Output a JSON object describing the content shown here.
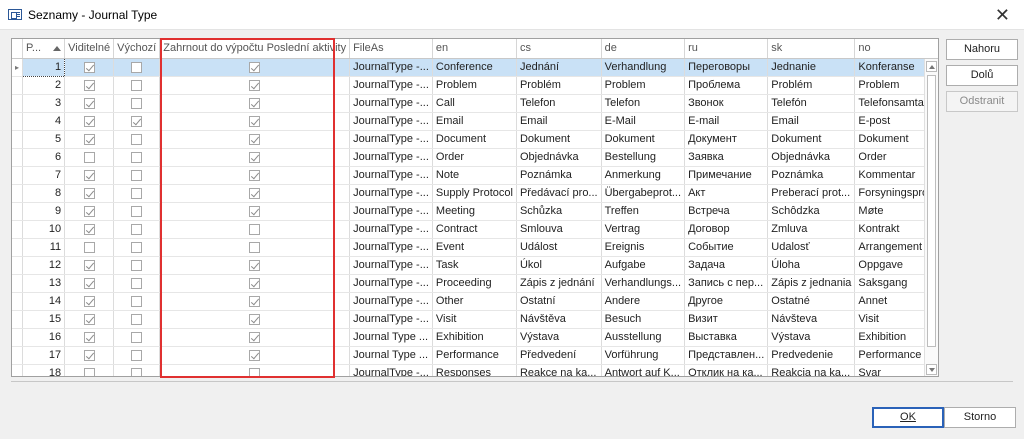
{
  "window": {
    "title": "Seznamy - Journal Type",
    "close_label": "✕"
  },
  "columns": [
    "P...",
    "Viditelné",
    "Výchozí",
    "Zahrnout do výpočtu Poslední aktivity",
    "FileAs",
    "en",
    "cs",
    "de",
    "ru",
    "sk",
    "no"
  ],
  "rows": [
    {
      "p": "1",
      "vis": true,
      "def": false,
      "incl": true,
      "fileas": "JournalType -...",
      "en": "Conference",
      "cs": "Jednání",
      "de": "Verhandlung",
      "ru": "Переговоры",
      "sk": "Jednanie",
      "no": "Konferanse"
    },
    {
      "p": "2",
      "vis": true,
      "def": false,
      "incl": true,
      "fileas": "JournalType -...",
      "en": "Problem",
      "cs": "Problém",
      "de": "Problem",
      "ru": "Проблема",
      "sk": "Problém",
      "no": "Problem"
    },
    {
      "p": "3",
      "vis": true,
      "def": false,
      "incl": true,
      "fileas": "JournalType -...",
      "en": "Call",
      "cs": "Telefon",
      "de": "Telefon",
      "ru": "Звонок",
      "sk": "Telefón",
      "no": "Telefonsamtale"
    },
    {
      "p": "4",
      "vis": true,
      "def": true,
      "incl": true,
      "fileas": "JournalType -...",
      "en": "Email",
      "cs": "Email",
      "de": "E-Mail",
      "ru": "E-mail",
      "sk": "Email",
      "no": "E-post"
    },
    {
      "p": "5",
      "vis": true,
      "def": false,
      "incl": true,
      "fileas": "JournalType -...",
      "en": "Document",
      "cs": "Dokument",
      "de": "Dokument",
      "ru": "Документ",
      "sk": "Dokument",
      "no": "Dokument"
    },
    {
      "p": "6",
      "vis": false,
      "def": false,
      "incl": true,
      "fileas": "JournalType -...",
      "en": "Order",
      "cs": "Objednávka",
      "de": "Bestellung",
      "ru": "Заявка",
      "sk": "Objednávka",
      "no": "Order"
    },
    {
      "p": "7",
      "vis": true,
      "def": false,
      "incl": true,
      "fileas": "JournalType -...",
      "en": "Note",
      "cs": "Poznámka",
      "de": "Anmerkung",
      "ru": "Примечание",
      "sk": "Poznámka",
      "no": "Kommentar"
    },
    {
      "p": "8",
      "vis": true,
      "def": false,
      "incl": true,
      "fileas": "JournalType -...",
      "en": "Supply Protocol",
      "cs": "Předávací pro...",
      "de": "Übergabeprot...",
      "ru": "Акт",
      "sk": "Preberací prot...",
      "no": "Forsyningsprotokoll"
    },
    {
      "p": "9",
      "vis": true,
      "def": false,
      "incl": true,
      "fileas": "JournalType -...",
      "en": "Meeting",
      "cs": "Schůzka",
      "de": "Treffen",
      "ru": "Встреча",
      "sk": "Schôdzka",
      "no": "Møte"
    },
    {
      "p": "10",
      "vis": true,
      "def": false,
      "incl": false,
      "fileas": "JournalType -...",
      "en": "Contract",
      "cs": "Smlouva",
      "de": "Vertrag",
      "ru": "Договор",
      "sk": "Zmluva",
      "no": "Kontrakt"
    },
    {
      "p": "11",
      "vis": false,
      "def": false,
      "incl": false,
      "fileas": "JournalType -...",
      "en": "Event",
      "cs": "Událost",
      "de": "Ereignis",
      "ru": "Событие",
      "sk": "Udalosť",
      "no": "Arrangement"
    },
    {
      "p": "12",
      "vis": true,
      "def": false,
      "incl": true,
      "fileas": "JournalType -...",
      "en": "Task",
      "cs": "Úkol",
      "de": "Aufgabe",
      "ru": "Задача",
      "sk": "Úloha",
      "no": "Oppgave"
    },
    {
      "p": "13",
      "vis": true,
      "def": false,
      "incl": true,
      "fileas": "JournalType -...",
      "en": "Proceeding",
      "cs": "Zápis z jednání",
      "de": "Verhandlungs...",
      "ru": "Запись с пер...",
      "sk": "Zápis z jednania",
      "no": "Saksgang"
    },
    {
      "p": "14",
      "vis": true,
      "def": false,
      "incl": true,
      "fileas": "JournalType -...",
      "en": "Other",
      "cs": "Ostatní",
      "de": "Andere",
      "ru": "Другое",
      "sk": "Ostatné",
      "no": "Annet"
    },
    {
      "p": "15",
      "vis": true,
      "def": false,
      "incl": true,
      "fileas": "JournalType -...",
      "en": "Visit",
      "cs": "Návštěva",
      "de": "Besuch",
      "ru": "Визит",
      "sk": "Návšteva",
      "no": "Visit"
    },
    {
      "p": "16",
      "vis": true,
      "def": false,
      "incl": true,
      "fileas": "Journal Type ...",
      "en": "Exhibition",
      "cs": "Výstava",
      "de": "Ausstellung",
      "ru": "Выставка",
      "sk": "Výstava",
      "no": "Exhibition"
    },
    {
      "p": "17",
      "vis": true,
      "def": false,
      "incl": true,
      "fileas": "Journal Type ...",
      "en": "Performance",
      "cs": "Předvedení",
      "de": "Vorführung",
      "ru": "Представлен...",
      "sk": "Predvedenie",
      "no": "Performance"
    },
    {
      "p": "18",
      "vis": false,
      "def": false,
      "incl": false,
      "fileas": "JournalType -...",
      "en": "Responses",
      "cs": "Reakce na ka...",
      "de": "Antwort auf K...",
      "ru": "Отклик на ка...",
      "sk": "Reakcia na ka...",
      "no": "Svar"
    }
  ],
  "buttons": {
    "up": "Nahoru",
    "down": "Dolů",
    "remove": "Odstranit",
    "ok": "OK",
    "cancel": "Storno"
  },
  "colors": {
    "selection": "#c9e1f6",
    "highlight": "#e03030",
    "ok_border": "#2a62b8"
  }
}
